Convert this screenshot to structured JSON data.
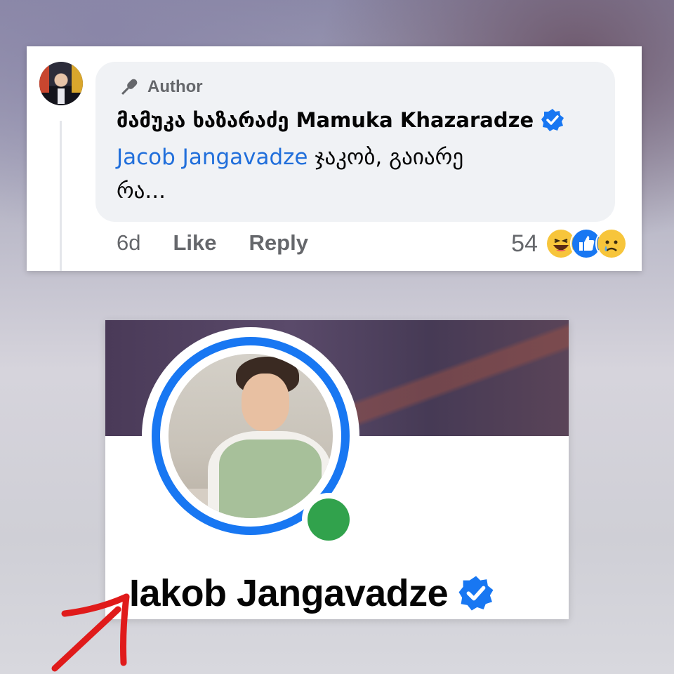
{
  "comment": {
    "author_label": "Author",
    "name": "მამუკა ხაზარაძე Mamuka Khazaradze",
    "mention": "Jacob Jangavadze",
    "text_line1": " ჯაკობ, გაიარე",
    "text_line2": "რა...",
    "time": "6d",
    "like_label": "Like",
    "reply_label": "Reply",
    "reaction_count": "54",
    "reactions": [
      "haha-icon",
      "like-icon",
      "sad-icon"
    ]
  },
  "profile": {
    "name": "Iakob Jangavadze",
    "online": true
  },
  "colors": {
    "verified": "#1877f2",
    "mention": "#216fdb",
    "online": "#31a24c",
    "arrow": "#e01b1b"
  }
}
